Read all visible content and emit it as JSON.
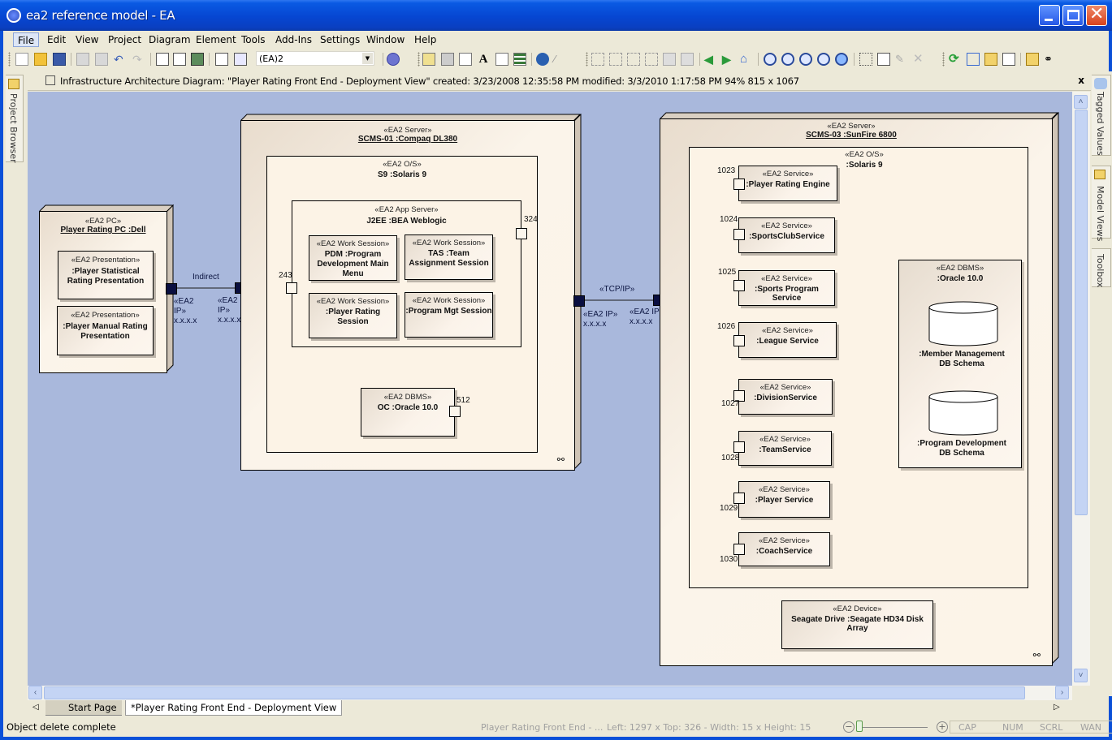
{
  "window": {
    "title": "ea2 reference model - EA",
    "controls": [
      "minimize",
      "maximize",
      "close"
    ]
  },
  "menu": [
    "File",
    "Edit",
    "View",
    "Project",
    "Diagram",
    "Element",
    "Tools",
    "Add-Ins",
    "Settings",
    "Window",
    "Help"
  ],
  "toolbar": {
    "workspace_combo_value": "(EA)2",
    "icons": [
      "new-icon",
      "open-icon",
      "save-icon",
      "copy-icon",
      "paste-icon",
      "undo-icon",
      "redo-icon",
      "print-preview-icon",
      "page-setup-icon",
      "print-icon",
      "list-icon",
      "search-icon",
      "help-icon",
      "element-properties-icon",
      "appearance-icon",
      "notes-icon",
      "font-icon",
      "hyperlink-icon",
      "feature-list-icon",
      "web-icon",
      "connector-icon",
      "align-left-icon",
      "align-right-icon",
      "align-top-icon",
      "align-bottom-icon",
      "bring-forward-icon",
      "send-backward-icon",
      "back-icon",
      "forward-icon",
      "home-icon",
      "zoom-in-icon",
      "zoom-out-icon",
      "zoom-100-icon",
      "zoom-fit-icon",
      "zoom-page-icon",
      "layout-icon",
      "properties-icon",
      "paint-icon",
      "delete-icon",
      "refresh-icon",
      "hierarchy-icon",
      "folder-icon",
      "document-icon",
      "find-folder-icon",
      "binoculars-icon"
    ]
  },
  "diagram_header": {
    "text": "Infrastructure Architecture Diagram: \"Player Rating Front End - Deployment View\"   created: 3/23/2008 12:35:58 PM  modified: 3/3/2010 1:17:58 PM   94%   815 x 1067",
    "close": "x"
  },
  "docks": {
    "left": [
      "Project Browser"
    ],
    "right": [
      "Tagged Values",
      "Model Views",
      "Toolbox"
    ]
  },
  "diagram": {
    "pc": {
      "stereotype": "«EA2 PC»",
      "name": "Player Rating PC :Dell",
      "children": [
        {
          "stereotype": "«EA2 Presentation»",
          "name": ":Player Statistical Rating Presentation"
        },
        {
          "stereotype": "«EA2 Presentation»",
          "name": ":Player Manual Rating Presentation"
        }
      ]
    },
    "link_indirect": "Indirect",
    "ip_label_stereo": "«EA2 IP»",
    "ip_label_stereo_a": "«EA2",
    "ip_label_stereo_b": "IP»",
    "ip_addr": "x.x.x.x",
    "server1": {
      "stereotype": "«EA2 Server»",
      "name": "SCMS-01 :Compaq DL380",
      "os": {
        "stereotype": "«EA2 O/S»",
        "name": "S9 :Solaris 9"
      },
      "app_server": {
        "stereotype": "«EA2 App Server»",
        "name": "J2EE :BEA Weblogic"
      },
      "sessions": [
        {
          "stereotype": "«EA2 Work Session»",
          "name": "PDM :Program Development Main Menu"
        },
        {
          "stereotype": "«EA2 Work Session»",
          "name": "TAS :Team Assignment Session"
        },
        {
          "stereotype": "«EA2 Work Session»",
          "name": ":Player Rating Session"
        },
        {
          "stereotype": "«EA2 Work Session»",
          "name": ":Program Mgt Session"
        }
      ],
      "dbms": {
        "stereotype": "«EA2 DBMS»",
        "name": "OC :Oracle 10.0"
      },
      "ports": {
        "p243": "243",
        "p324": "324",
        "p512": "512"
      }
    },
    "link_tcpip": "«TCP/IP»",
    "server3": {
      "stereotype": "«EA2 Server»",
      "name": "SCMS-03 :SunFire 6800",
      "os": {
        "stereotype": "«EA2 O/S»",
        "name": ":Solaris 9"
      },
      "services": [
        {
          "port": "1023",
          "stereotype": "«EA2 Service»",
          "name": ":Player Rating Engine"
        },
        {
          "port": "1024",
          "stereotype": "«EA2 Service»",
          "name": ":SportsClubService"
        },
        {
          "port": "1025",
          "stereotype": "«EA2 Service»",
          "name": ":Sports Program Service"
        },
        {
          "port": "1026",
          "stereotype": "«EA2 Service»",
          "name": ":League Service"
        },
        {
          "port": "1027",
          "stereotype": "«EA2 Service»",
          "name": ":DivisionService"
        },
        {
          "port": "1028",
          "stereotype": "«EA2 Service»",
          "name": ":TeamService"
        },
        {
          "port": "1029",
          "stereotype": "«EA2 Service»",
          "name": ":Player Service"
        },
        {
          "port": "1030",
          "stereotype": "«EA2 Service»",
          "name": ":CoachService"
        }
      ],
      "dbms": {
        "stereotype": "«EA2 DBMS»",
        "name": ":Oracle 10.0",
        "schemas": [
          ":Member Management DB Schema",
          ":Program Development DB Schema"
        ]
      },
      "device": {
        "stereotype": "«EA2 Device»",
        "name": "Seagate Drive :Seagate HD34 Disk Array"
      }
    }
  },
  "tabs": [
    {
      "label": "Start Page",
      "active": false
    },
    {
      "label": "*Player Rating Front End - Deployment View",
      "active": true
    }
  ],
  "status": {
    "message": "Object delete complete",
    "diagram": "Player Rating Front End - ...",
    "geometry": "Left: 1297 x Top:  326 - Width:  15 x Height:  15",
    "indicators": [
      "CAP",
      "NUM",
      "SCRL",
      "WAN"
    ]
  },
  "colors": {
    "canvas": "#a9b8dc",
    "node_fill": "#fbf4ea",
    "ip_port": "#0a0f40",
    "titlebar": "#0646d2"
  }
}
